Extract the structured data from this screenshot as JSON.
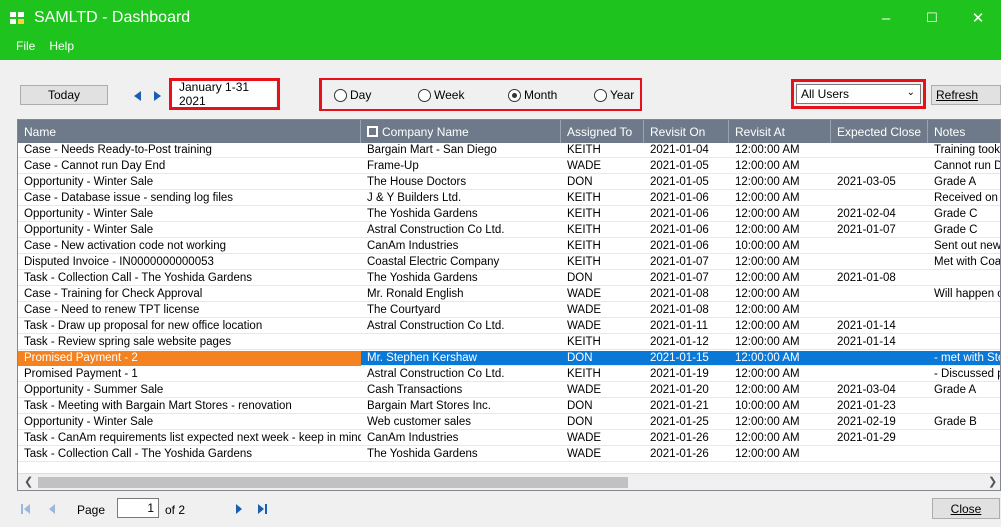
{
  "window": {
    "title": "SAMLTD - Dashboard",
    "minimize": "–",
    "maximize": "☐",
    "close": "✕"
  },
  "menu": {
    "file": "File",
    "help": "Help"
  },
  "toolbar": {
    "today": "Today",
    "date_range": "January 1-31 2021",
    "periods": [
      "Day",
      "Week",
      "Month",
      "Year"
    ],
    "selected_period": "Month",
    "user_filter": "All Users",
    "refresh": "Refresh"
  },
  "grid": {
    "columns": [
      "Name",
      "Company Name",
      "Assigned To",
      "Revisit On",
      "Revisit At",
      "Expected Close",
      "Notes"
    ],
    "rows": [
      [
        "Case - Needs Ready-to-Post training",
        "Bargain Mart - San Diego",
        "KEITH",
        "2021-01-04",
        "12:00:00 AM",
        "",
        "Training took p"
      ],
      [
        "Case - Cannot run Day End",
        "Frame-Up",
        "WADE",
        "2021-01-05",
        "12:00:00 AM",
        "",
        "Cannot run Day"
      ],
      [
        "Opportunity - Winter Sale",
        "The House Doctors",
        "DON",
        "2021-01-05",
        "12:00:00 AM",
        "2021-03-05",
        "Grade A"
      ],
      [
        "Case - Database issue - sending log files",
        "J & Y Builders Ltd.",
        "KEITH",
        "2021-01-06",
        "12:00:00 AM",
        "",
        "Received on J"
      ],
      [
        "Opportunity - Winter Sale",
        "The Yoshida Gardens",
        "KEITH",
        "2021-01-06",
        "12:00:00 AM",
        "2021-02-04",
        "Grade C"
      ],
      [
        "Opportunity - Winter Sale",
        "Astral Construction Co Ltd.",
        "KEITH",
        "2021-01-06",
        "12:00:00 AM",
        "2021-01-07",
        "Grade C"
      ],
      [
        "Case - New activation code not working",
        "CanAm Industries",
        "KEITH",
        "2021-01-06",
        "10:00:00 AM",
        "",
        "Sent out new c"
      ],
      [
        "Disputed Invoice - IN0000000000053",
        "Coastal Electric Company",
        "KEITH",
        "2021-01-07",
        "12:00:00 AM",
        "",
        "Met with Coast"
      ],
      [
        "Task - Collection Call - The Yoshida Gardens",
        "The Yoshida Gardens",
        "DON",
        "2021-01-07",
        "12:00:00 AM",
        "2021-01-08",
        ""
      ],
      [
        "Case - Training for Check Approval",
        "Mr. Ronald English",
        "WADE",
        "2021-01-08",
        "12:00:00 AM",
        "",
        "Will happen on"
      ],
      [
        "Case - Need to renew TPT license",
        "The Courtyard",
        "WADE",
        "2021-01-08",
        "12:00:00 AM",
        "",
        ""
      ],
      [
        "Task - Draw up proposal for new office location",
        "Astral Construction Co Ltd.",
        "WADE",
        "2021-01-11",
        "12:00:00 AM",
        "2021-01-14",
        ""
      ],
      [
        "Task - Review spring sale website pages",
        "",
        "KEITH",
        "2021-01-12",
        "12:00:00 AM",
        "2021-01-14",
        ""
      ],
      [
        "Promised Payment - 2",
        "Mr. Stephen Kershaw",
        "DON",
        "2021-01-15",
        "12:00:00 AM",
        "",
        "- met with Step"
      ],
      [
        "Promised Payment - 1",
        "Astral Construction Co Ltd.",
        "KEITH",
        "2021-01-19",
        "12:00:00 AM",
        "",
        "- Discussed pa"
      ],
      [
        "Opportunity - Summer Sale",
        "Cash Transactions",
        "WADE",
        "2021-01-20",
        "12:00:00 AM",
        "2021-03-04",
        "Grade A"
      ],
      [
        "Task - Meeting with Bargain Mart Stores - renovation",
        "Bargain Mart Stores Inc.",
        "DON",
        "2021-01-21",
        "10:00:00 AM",
        "2021-01-23",
        ""
      ],
      [
        "Opportunity - Winter Sale",
        "Web customer sales",
        "DON",
        "2021-01-25",
        "12:00:00 AM",
        "2021-02-19",
        "Grade B"
      ],
      [
        "Task - CanAm requirements list expected next week - keep in mind",
        "CanAm Industries",
        "WADE",
        "2021-01-26",
        "12:00:00 AM",
        "2021-01-29",
        ""
      ],
      [
        "Task - Collection Call - The Yoshida Gardens",
        "The Yoshida Gardens",
        "WADE",
        "2021-01-26",
        "12:00:00 AM",
        "",
        ""
      ]
    ],
    "selected_row": 13
  },
  "pager": {
    "page_label": "Page",
    "page": "1",
    "of_label": "of 2"
  },
  "footer": {
    "close": "Close"
  },
  "colors": {
    "title_bar": "#1ec31e",
    "highlight": "#e8101a",
    "selection": "#0a78d7",
    "selection_first": "#f58220",
    "header": "#6e7a8a"
  }
}
